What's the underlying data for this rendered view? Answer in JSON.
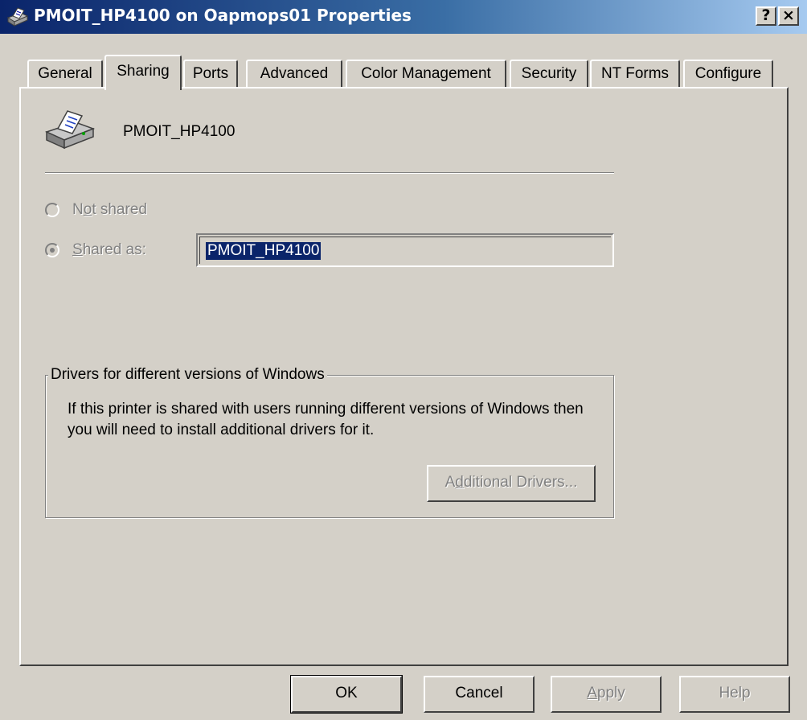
{
  "window": {
    "title": "PMOIT_HP4100 on Oapmops01 Properties",
    "help_button": "?",
    "close_button": "×"
  },
  "tabs": [
    {
      "label": "General",
      "active": false
    },
    {
      "label": "Sharing",
      "active": true
    },
    {
      "label": "Ports",
      "active": false
    },
    {
      "label": "Advanced",
      "active": false
    },
    {
      "label": "Color Management",
      "active": false
    },
    {
      "label": "Security",
      "active": false
    },
    {
      "label": "NT Forms",
      "active": false
    },
    {
      "label": "Configure",
      "active": false
    }
  ],
  "sharing": {
    "printer_name": "PMOIT_HP4100",
    "not_shared": {
      "pre": "N",
      "accel": "o",
      "post": "t shared",
      "selected": false,
      "enabled": false
    },
    "shared_as": {
      "pre": "",
      "accel": "S",
      "post": "hared as:",
      "selected": true,
      "enabled": false
    },
    "share_name_value": "PMOIT_HP4100"
  },
  "drivers_group": {
    "legend": "Drivers for different versions of Windows",
    "description": "If this printer is shared with users running different versions of Windows then you will need to install additional drivers for it.",
    "button": {
      "pre": "A",
      "accel": "d",
      "post": "ditional Drivers...",
      "enabled": false
    }
  },
  "buttons": {
    "ok": "OK",
    "cancel": "Cancel",
    "apply": {
      "pre": "",
      "accel": "A",
      "post": "pply",
      "enabled": false
    },
    "help": "Help"
  },
  "colors": {
    "title_bar_start": "#0a246a",
    "title_bar_end": "#a6caf0",
    "face": "#d4d0c8",
    "disabled_text": "#808080",
    "selection": "#0a246a"
  },
  "icons": [
    "printer-icon",
    "radio-icon"
  ]
}
